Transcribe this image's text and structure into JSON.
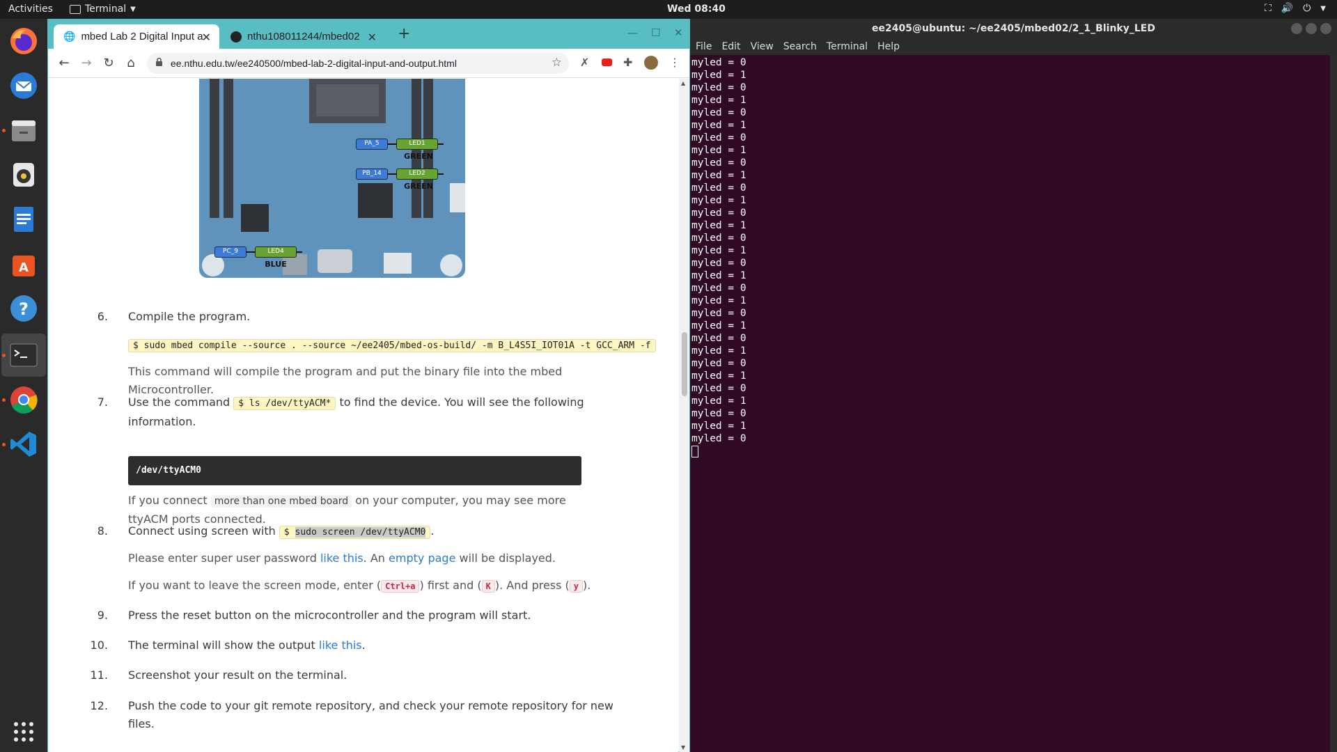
{
  "topbar": {
    "activities": "Activities",
    "app_name": "Terminal",
    "clock": "Wed 08:40"
  },
  "browser": {
    "tabs": [
      {
        "label": "mbed Lab 2 Digital Input a"
      },
      {
        "label": "nthu108011244/mbed02"
      }
    ],
    "url": "ee.nthu.edu.tw/ee240500/mbed-lab-2-digital-input-and-output.html"
  },
  "board": {
    "pins": [
      {
        "pin": "PA_5",
        "led": "LED1",
        "color_label": "GREEN"
      },
      {
        "pin": "PB_14",
        "led": "LED2",
        "color_label": "GREEN"
      },
      {
        "pin": "PC_9",
        "led": "LED4",
        "color_label": "BLUE"
      }
    ]
  },
  "doc": {
    "step6": {
      "num": "6.",
      "text": "Compile the program.",
      "code": "$ sudo mbed compile --source . --source ~/ee2405/mbed-os-build/ -m B_L4S5I_IOT01A -t GCC_ARM -f",
      "note_line1": "This command will compile the program and put the binary file into the mbed",
      "note_line2": "Microcontroller."
    },
    "step7": {
      "num": "7.",
      "pre": "Use the command",
      "code": "$ ls /dev/ttyACM*",
      "post": "to find the device. You will see the following",
      "line2": "information.",
      "block": "/dev/ttyACM0",
      "note_pre": "If you connect",
      "note_code": "more than one mbed board",
      "note_post": "on your computer, you may see more",
      "note_line2": "ttyACM ports connected."
    },
    "step8": {
      "num": "8.",
      "pre": "Connect using screen with",
      "code_dollar": "$",
      "code": "sudo screen /dev/ttyACM0",
      "post": ".",
      "p1_pre": "Please enter super user password",
      "p1_link": "like this",
      "p1_mid": ". An",
      "p1_link2": "empty page",
      "p1_post": "will be displayed.",
      "p2_a": "If you want to leave the screen mode, enter (",
      "p2_k1": "Ctrl+a",
      "p2_b": ") first and (",
      "p2_k2": "K",
      "p2_c": "). And press (",
      "p2_k3": "y",
      "p2_d": ")."
    },
    "step9": {
      "num": "9.",
      "text": "Press the reset button on the microcontroller and the program will start."
    },
    "step10": {
      "num": "10.",
      "pre": "The terminal will show the output",
      "link": "like this",
      "post": "."
    },
    "step11": {
      "num": "11.",
      "text": "Screenshot your result on the terminal."
    },
    "step12": {
      "num": "12.",
      "line1": "Push the code to your git remote repository, and check your remote repository for new",
      "line2": "files."
    }
  },
  "terminal": {
    "title": "ee2405@ubuntu: ~/ee2405/mbed02/2_1_Blinky_LED",
    "menu": [
      "File",
      "Edit",
      "View",
      "Search",
      "Terminal",
      "Help"
    ],
    "lines": [
      "myled = 0",
      "myled = 1",
      "myled = 0",
      "myled = 1",
      "myled = 0",
      "myled = 1",
      "myled = 0",
      "myled = 1",
      "myled = 0",
      "myled = 1",
      "myled = 0",
      "myled = 1",
      "myled = 0",
      "myled = 1",
      "myled = 0",
      "myled = 1",
      "myled = 0",
      "myled = 1",
      "myled = 0",
      "myled = 1",
      "myled = 0",
      "myled = 1",
      "myled = 0",
      "myled = 1",
      "myled = 0",
      "myled = 1",
      "myled = 0",
      "myled = 1",
      "myled = 0",
      "myled = 1",
      "myled = 0"
    ]
  }
}
